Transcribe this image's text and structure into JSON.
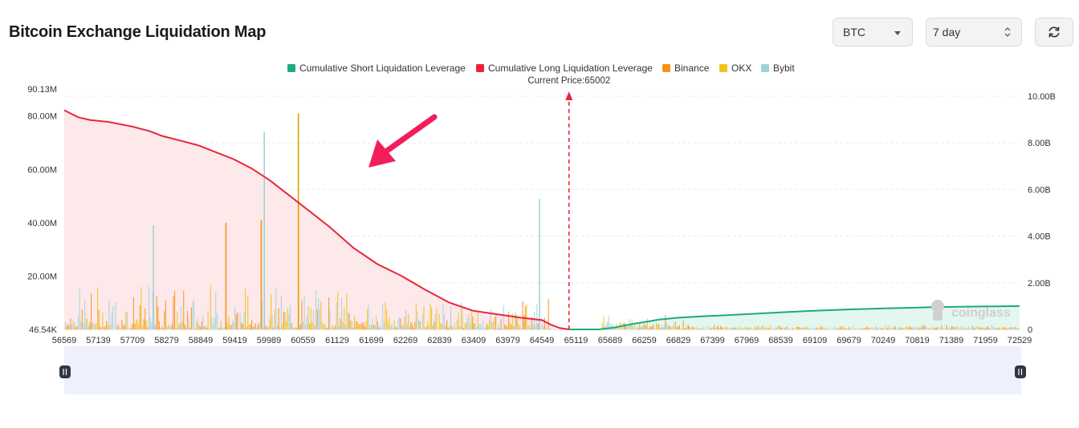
{
  "header": {
    "title": "Bitcoin Exchange Liquidation Map",
    "coin_select": "BTC",
    "range_select": "7 day",
    "refresh_icon": "refresh-icon"
  },
  "colors": {
    "short_cum": "#1ea883",
    "long_cum": "#e8263b",
    "binance": "#f7931a",
    "okx": "#f0c419",
    "bybit": "#9ed3d8",
    "arrow": "#f21e5a"
  },
  "chart_data": {
    "type": "bar",
    "legend": [
      "Cumulative Short Liquidation Leverage",
      "Cumulative Long Liquidation Leverage",
      "Binance",
      "OKX",
      "Bybit"
    ],
    "legend_placement": "top-center",
    "annotation": "Current Price:65002",
    "current_price": 65002,
    "xlim": [
      56569,
      72529
    ],
    "x_ticks": [
      "56569",
      "57139",
      "57709",
      "58279",
      "58849",
      "59419",
      "59989",
      "60559",
      "61129",
      "61699",
      "62269",
      "62839",
      "63409",
      "63979",
      "64549",
      "65119",
      "65689",
      "66259",
      "66829",
      "67399",
      "67969",
      "68539",
      "69109",
      "69679",
      "70249",
      "70819",
      "71389",
      "71959",
      "72529"
    ],
    "y_left": {
      "ticks": [
        "46.54K",
        "20.00M",
        "40.00M",
        "60.00M",
        "80.00M",
        "90.13M"
      ],
      "range": [
        46540,
        90130000
      ]
    },
    "y_right": {
      "ticks": [
        "0",
        "2.00B",
        "4.00B",
        "6.00B",
        "8.00B",
        "10.00B"
      ],
      "range": [
        0,
        10000000000
      ]
    },
    "grid": true,
    "series": [
      {
        "name": "Cumulative Long Liquidation Leverage",
        "type": "area",
        "x": [
          56569,
          56800,
          57000,
          57300,
          57700,
          58000,
          58200,
          58500,
          58800,
          59100,
          59400,
          59700,
          60000,
          60300,
          60600,
          61000,
          61400,
          61800,
          62200,
          62600,
          63000,
          63400,
          63800,
          64200,
          64550,
          64700,
          64850,
          65002
        ],
        "y": [
          9400000000,
          9100000000,
          8980000000,
          8900000000,
          8700000000,
          8500000000,
          8300000000,
          8100000000,
          7900000000,
          7600000000,
          7300000000,
          6900000000,
          6400000000,
          5800000000,
          5200000000,
          4400000000,
          3500000000,
          2800000000,
          2300000000,
          1700000000,
          1150000000,
          800000000,
          650000000,
          500000000,
          400000000,
          200000000,
          60000000,
          0
        ]
      },
      {
        "name": "Cumulative Short Liquidation Leverage",
        "type": "area",
        "x": [
          65002,
          65500,
          65700,
          65900,
          66100,
          66300,
          66500,
          66829,
          67200,
          67700,
          68300,
          69000,
          69700,
          70400,
          71000,
          71600,
          72100,
          72529
        ],
        "y": [
          0,
          0,
          60000000,
          150000000,
          250000000,
          330000000,
          420000000,
          500000000,
          560000000,
          620000000,
          700000000,
          790000000,
          860000000,
          910000000,
          950000000,
          975000000,
          990000000,
          1000000000
        ]
      }
    ],
    "notable_bars": [
      {
        "exchange": "OKX",
        "x": 60470,
        "value": 81000000
      },
      {
        "exchange": "Bybit",
        "x": 59900,
        "value": 74000000
      },
      {
        "exchange": "Bybit",
        "x": 64500,
        "value": 49000000
      },
      {
        "exchange": "Binance",
        "x": 59850,
        "value": 41000000
      },
      {
        "exchange": "Bybit",
        "x": 58050,
        "value": 39000000
      },
      {
        "exchange": "Binance",
        "x": 59260,
        "value": 40000000
      }
    ],
    "watermark": "coinglass"
  }
}
